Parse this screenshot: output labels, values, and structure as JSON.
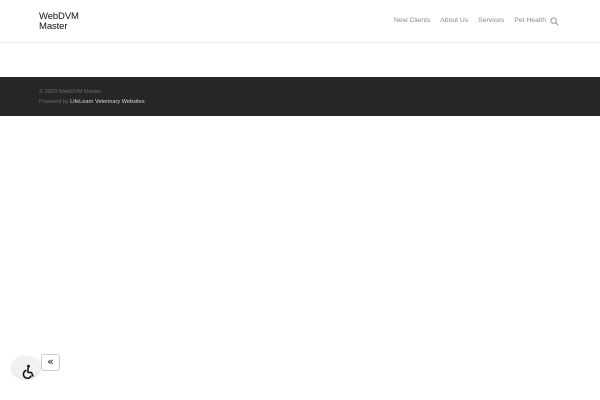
{
  "header": {
    "logo_line1": "WebDVM",
    "logo_line2": "Master",
    "nav": [
      {
        "label": "New Clients"
      },
      {
        "label": "About Us"
      },
      {
        "label": "Services"
      },
      {
        "label": "Pet Health"
      }
    ],
    "search_icon": "search-icon"
  },
  "footer": {
    "copyright": "© 2023 WebDVM Master.",
    "powered_prefix": "Powered by ",
    "powered_link": "LifeLearn Veterinary Websites"
  },
  "accessibility": {
    "icon": "wheelchair-icon",
    "collapse_label": "«"
  },
  "colors": {
    "footer_bg": "#262626",
    "nav_text": "#8a8a8a"
  }
}
